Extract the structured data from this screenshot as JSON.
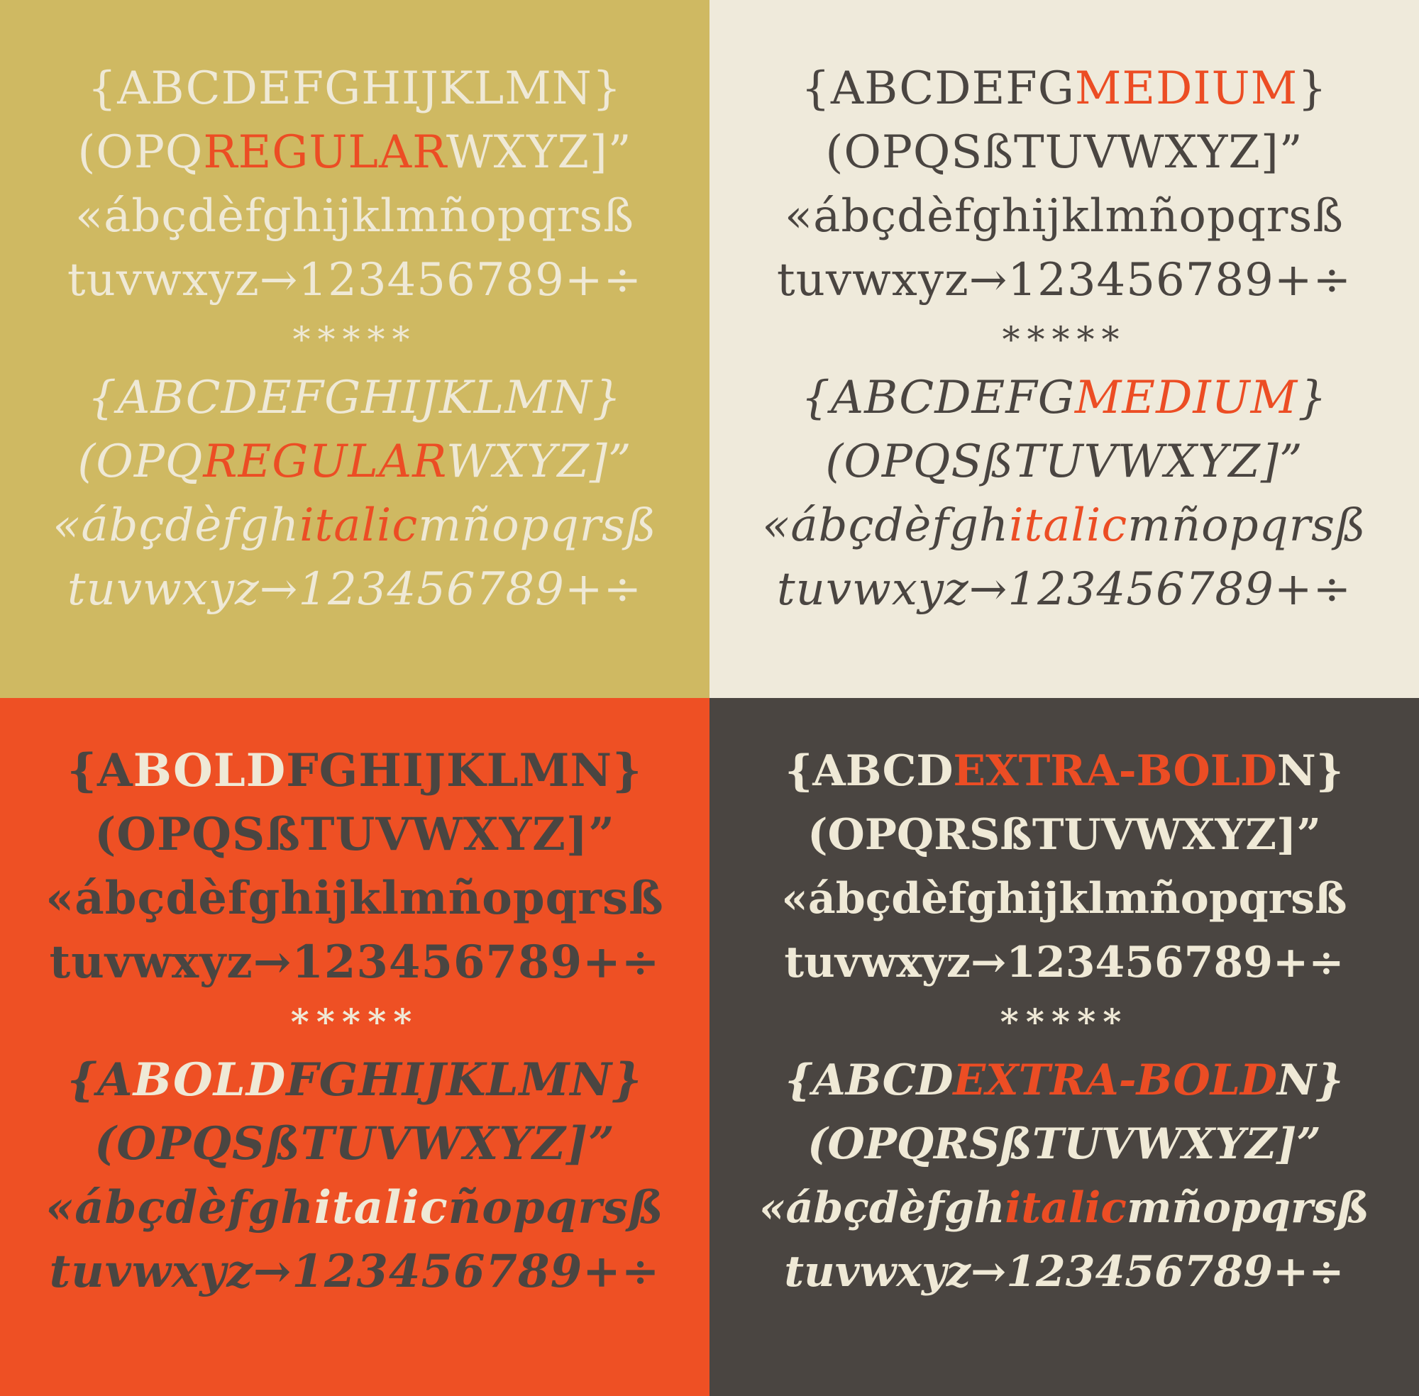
{
  "colors": {
    "gold": "#cfb962",
    "cream": "#efeadb",
    "orange": "#ee5024",
    "charcoal": "#4a4541",
    "accent_red": "#ec4d24",
    "light_text": "#efe9d6",
    "dark_text": "#4a4541"
  },
  "regular": {
    "roman": {
      "l1": "{ABCDEFGHIJKLMN}",
      "l2_a": "(OPQ",
      "l2_hl": "REGULAR",
      "l2_b": "WXYZ]”",
      "l3": "«ábçdèfghijklmñopqrsß",
      "l4": "tuvwxyz→123456789+÷"
    },
    "stars": "*****",
    "italic": {
      "l1": "{ABCDEFGHIJKLMN}",
      "l2_a": "(OPQ",
      "l2_hl": "REGULAR",
      "l2_b": "WXYZ]”",
      "l3_a": "«ábçdèfgh",
      "l3_hl": "italic",
      "l3_b": "mñopqrsß",
      "l4": "tuvwxyz→123456789+÷"
    }
  },
  "medium": {
    "roman": {
      "l1_a": "{ABCDEFG",
      "l1_hl": "MEDIUM",
      "l1_b": "}",
      "l2": "(OPQSßTUVWXYZ]”",
      "l3": "«ábçdèfghijklmñopqrsß",
      "l4": "tuvwxyz→123456789+÷"
    },
    "stars": "*****",
    "italic": {
      "l1_a": "{ABCDEFG",
      "l1_hl": "MEDIUM",
      "l1_b": "}",
      "l2": "(OPQSßTUVWXYZ]”",
      "l3_a": "«ábçdèfgh",
      "l3_hl": "italic",
      "l3_b": "mñopqrsß",
      "l4": "tuvwxyz→123456789+÷"
    }
  },
  "bold": {
    "roman": {
      "l1_a": "{A",
      "l1_hl": "BOLD",
      "l1_b": "FGHIJKLMN}",
      "l2": "(OPQSßTUVWXYZ]”",
      "l3": "«ábçdèfghijklmñopqrsß",
      "l4": "tuvwxyz→123456789+÷"
    },
    "stars": "*****",
    "italic": {
      "l1_a": "{A",
      "l1_hl": "BOLD",
      "l1_b": "FGHIJKLMN}",
      "l2": "(OPQSßTUVWXYZ]”",
      "l3_a": "«ábçdèfgh",
      "l3_hl": "italic",
      "l3_b": "ñopqrsß",
      "l4": "tuvwxyz→123456789+÷"
    }
  },
  "extrabold": {
    "roman": {
      "l1_a": "{ABCD",
      "l1_hl": "EXTRA-BOLD",
      "l1_b": "N}",
      "l2": "(OPQRSßTUVWXYZ]”",
      "l3": "«ábçdèfghijklmñopqrsß",
      "l4": "tuvwxyz→123456789+÷"
    },
    "stars": "*****",
    "italic": {
      "l1_a": "{ABCD",
      "l1_hl": "EXTRA-BOLD",
      "l1_b": "N}",
      "l2": "(OPQRSßTUVWXYZ]”",
      "l3_a": "«ábçdèfgh",
      "l3_hl": "italic",
      "l3_b": "mñopqrsß",
      "l4": "tuvwxyz→123456789+÷"
    }
  }
}
